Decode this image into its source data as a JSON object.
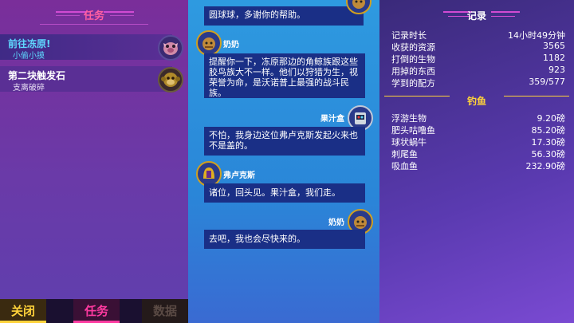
{
  "left_panel": {
    "title": "任务",
    "quests": [
      {
        "title": "前往冻原!",
        "subtitle": "小偷小摸",
        "icon": "pig-creature-icon"
      },
      {
        "title": "第二块触发石",
        "subtitle": "支离破碎",
        "icon": "monkey-creature-icon"
      }
    ],
    "tabs": {
      "close": "关闭",
      "quests": "任务",
      "data": "数据"
    }
  },
  "chat": {
    "messages": [
      {
        "speaker": "",
        "text": "圆球球，多谢你的帮助。",
        "side": "right",
        "avatar": "grandma-icon"
      },
      {
        "speaker": "奶奶",
        "text": "提醒你一下，冻原那边的角鲸族跟这些胶鸟族大不一样。他们以狩猎为生，视荣誉为命，是沃诺普上最强的战斗民族。",
        "side": "left",
        "avatar": "grandma-icon"
      },
      {
        "speaker": "果汁盒",
        "text": "不怕，我身边这位弗卢克斯发起火来也不是盖的。",
        "side": "right",
        "avatar": "juicebox-robot-icon"
      },
      {
        "speaker": "弗卢克斯",
        "text": "诸位，回头见。果汁盒，我们走。",
        "side": "left",
        "avatar": "flux-helmet-icon"
      },
      {
        "speaker": "奶奶",
        "text": "去吧，我也会尽快来的。",
        "side": "right",
        "avatar": "grandma-icon"
      }
    ]
  },
  "stats": {
    "record_title": "记录",
    "records": [
      {
        "label": "记录时长",
        "value": "14小时49分钟"
      },
      {
        "label": "收获的资源",
        "value": "3565"
      },
      {
        "label": "打倒的生物",
        "value": "1182"
      },
      {
        "label": "用掉的东西",
        "value": "923"
      },
      {
        "label": "学到的配方",
        "value": "359/577"
      }
    ],
    "fishing_title": "钓鱼",
    "fish": [
      {
        "label": "浮游生物",
        "value": "9.20磅"
      },
      {
        "label": "肥头咕噜鱼",
        "value": "85.20磅"
      },
      {
        "label": "球状蜗牛",
        "value": "17.30磅"
      },
      {
        "label": "刺尾鱼",
        "value": "56.30磅"
      },
      {
        "label": "吸血鱼",
        "value": "232.90磅"
      }
    ]
  },
  "colors": {
    "accent_pink": "#ff3aa0",
    "accent_gold": "#ffd23a",
    "quest_active": "#5fd9ff",
    "bubble": "#1a2f86"
  }
}
